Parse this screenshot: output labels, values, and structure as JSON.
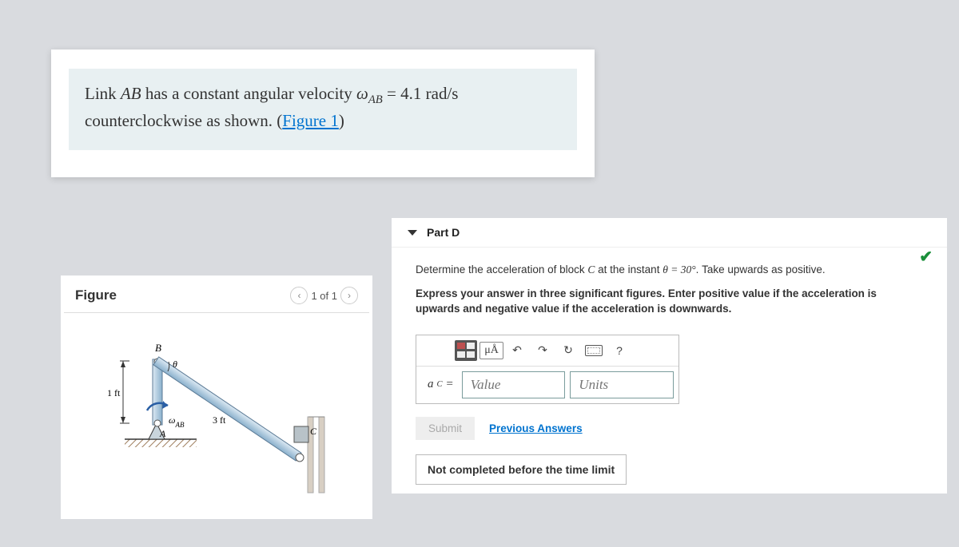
{
  "problem": {
    "text_prefix": "Link ",
    "link_name": "AB",
    "text_mid1": " has a constant angular velocity ",
    "omega": "ω",
    "omega_sub": "AB",
    "text_mid2": " = 4.1 rad/s counterclockwise as shown. (",
    "figure_link": "Figure 1",
    "text_suffix": ")"
  },
  "figure": {
    "title": "Figure",
    "pager": "1 of 1",
    "labels": {
      "B": "B",
      "A": "A",
      "C": "C",
      "theta": "θ",
      "omega_ab": "ωAB",
      "one_ft": "1 ft",
      "three_ft": "3 ft"
    }
  },
  "part": {
    "title": "Part D",
    "prompt_prefix": "Determine the acceleration of block ",
    "prompt_C": "C",
    "prompt_mid": " at the instant ",
    "prompt_theta": "θ = 30°",
    "prompt_suffix": ".  Take upwards as positive.",
    "instruction": "Express your answer in three significant figures. Enter positive value if the acceleration is upwards and negative value if the acceleration is downwards.",
    "toolbar": {
      "mu_a": "μÅ",
      "help": "?"
    },
    "lhs_var": "a",
    "lhs_sub": "C",
    "lhs_eq": " = ",
    "value_placeholder": "Value",
    "units_placeholder": "Units",
    "submit": "Submit",
    "previous": "Previous Answers",
    "status": "Not completed before the time limit"
  }
}
